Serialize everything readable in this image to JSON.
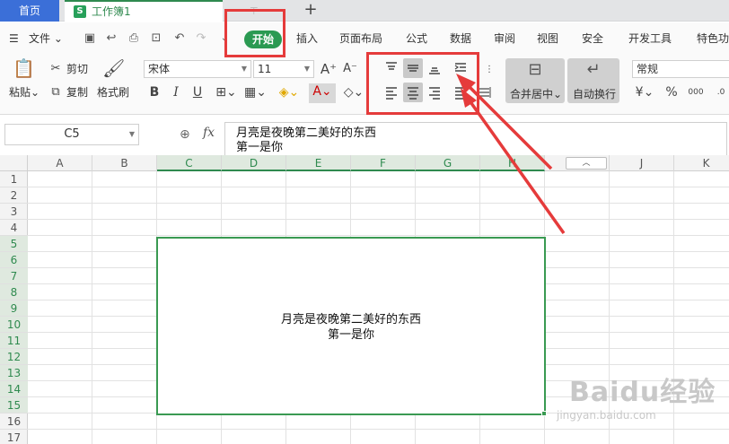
{
  "tabs": {
    "home": "首页",
    "workbook": "工作簿1",
    "add": "+"
  },
  "menu": {
    "file": "文件",
    "start": "开始",
    "items": [
      "插入",
      "页面布局",
      "公式",
      "数据",
      "审阅",
      "视图",
      "安全",
      "开发工具",
      "特色功"
    ]
  },
  "ribbon": {
    "paste": "粘贴",
    "cut": "剪切",
    "copy": "复制",
    "format_painter": "格式刷",
    "font_name": "宋体",
    "font_size": "11",
    "bold": "B",
    "italic": "I",
    "underline": "U",
    "merge_center": "合并居中",
    "wrap_text": "自动换行",
    "number_format": "常规",
    "percent": "%",
    "thousands": "000"
  },
  "formula_bar": {
    "name_box": "C5",
    "fx_label": "fx",
    "content_line1": "月亮是夜晚第二美好的东西",
    "content_line2": "第一是你"
  },
  "sheet": {
    "columns": [
      "A",
      "B",
      "C",
      "D",
      "E",
      "F",
      "G",
      "H",
      "I",
      "J",
      "K"
    ],
    "rows": [
      "1",
      "2",
      "3",
      "4",
      "5",
      "6",
      "7",
      "8",
      "9",
      "10",
      "11",
      "12",
      "13",
      "14",
      "15",
      "16",
      "17"
    ],
    "merged_cell_line1": "月亮是夜晚第二美好的东西",
    "merged_cell_line2": "第一是你"
  },
  "watermark": {
    "brand": "Baidu经验",
    "url": "jingyan.baidu.com"
  },
  "colors": {
    "accent_green": "#2b9a52",
    "tab_blue": "#3b6fd8",
    "annotation_red": "#e53b3b"
  }
}
